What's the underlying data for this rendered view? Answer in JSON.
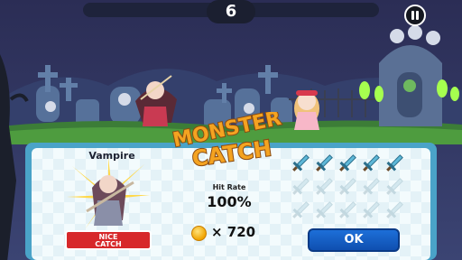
{
  "hud": {
    "counter": "6",
    "pause_icon": "pause-icon"
  },
  "logo": {
    "line1": "MONSTER",
    "line2": "CATCH"
  },
  "result": {
    "monster_name": "Vampire",
    "badge_line1": "NICE",
    "badge_line2": "CATCH",
    "hit_rate_label": "Hit Rate",
    "hit_rate_value": "100%",
    "coin_icon": "coin-icon",
    "coin_reward": "× 720",
    "ok_label": "OK"
  },
  "swords": {
    "total": 15,
    "filled": 5,
    "icon": "sword-icon"
  },
  "colors": {
    "panel_border": "#4aa3c8",
    "ok_button": "#1d6fd8",
    "badge": "#d7282a",
    "logo_fill": "#f4a321"
  }
}
